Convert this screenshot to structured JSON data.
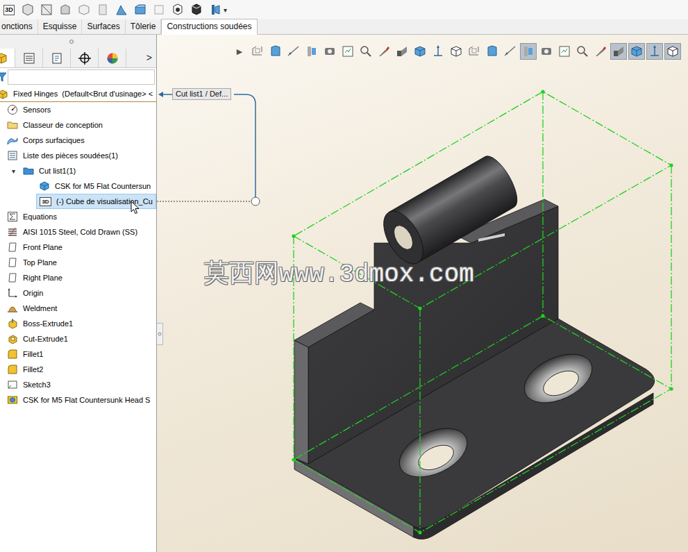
{
  "toolbar": {
    "badge": "3D",
    "dropdown": "▾"
  },
  "tabs": [
    {
      "label": "onctions",
      "selected": false
    },
    {
      "label": "Esquisse",
      "selected": false
    },
    {
      "label": "Surfaces",
      "selected": false
    },
    {
      "label": "Tôlerie",
      "selected": false
    },
    {
      "label": "Constructions soudées",
      "selected": true
    }
  ],
  "panel": {
    "tabs": [
      {
        "selected": true
      },
      {
        "selected": false
      },
      {
        "selected": false
      },
      {
        "selected": false
      },
      {
        "selected": false
      }
    ],
    "more": ">"
  },
  "tree": {
    "items": [
      {
        "label": "Fixed Hinges  (Default<Brut d'usinage> <",
        "depth": 0,
        "selected": false
      },
      {
        "label": "Sensors",
        "depth": 1,
        "selected": false
      },
      {
        "label": "Classeur de conception",
        "depth": 1,
        "selected": false
      },
      {
        "label": "Corps surfaciques",
        "depth": 1,
        "selected": false
      },
      {
        "label": "Liste des pièces soudées(1)",
        "depth": 1,
        "selected": false
      },
      {
        "label": "Cut list1(1)",
        "depth": 2,
        "toggle": "▾",
        "expanded": true,
        "selected": false
      },
      {
        "label": "CSK for M5 Flat Countersun",
        "depth": 3,
        "selected": false
      },
      {
        "label": "(-) Cube de visualisation_Cu",
        "depth": 3,
        "tag": "3D",
        "selected": true
      },
      {
        "label": "Equations",
        "depth": 1,
        "selected": false
      },
      {
        "label": "AISI 1015 Steel, Cold Drawn (SS)",
        "depth": 1,
        "selected": false
      },
      {
        "label": "Front Plane",
        "depth": 1,
        "selected": false
      },
      {
        "label": "Top Plane",
        "depth": 1,
        "selected": false
      },
      {
        "label": "Right Plane",
        "depth": 1,
        "selected": false
      },
      {
        "label": "Origin",
        "depth": 1,
        "selected": false
      },
      {
        "label": "Weldment",
        "depth": 1,
        "selected": false
      },
      {
        "label": "Boss-Extrude1",
        "depth": 1,
        "selected": false
      },
      {
        "label": "Cut-Extrude1",
        "depth": 1,
        "selected": false
      },
      {
        "label": "Fillet1",
        "depth": 1,
        "selected": false
      },
      {
        "label": "Fillet2",
        "depth": 1,
        "selected": false
      },
      {
        "label": "Sketch3",
        "depth": 1,
        "selected": false
      },
      {
        "label": "CSK for M5 Flat Countersunk Head S",
        "depth": 1,
        "selected": false
      }
    ]
  },
  "callout": {
    "text": "Cut list1 / Def..."
  },
  "watermark": "莫西网www.3dmox.com",
  "view_toolbar": {
    "expand": "▶",
    "buttons": [
      {
        "selected": false
      },
      {
        "selected": false
      },
      {
        "selected": false
      },
      {
        "selected": false
      },
      {
        "selected": false
      },
      {
        "selected": false
      },
      {
        "selected": false
      },
      {
        "selected": false
      },
      {
        "selected": false
      },
      {
        "selected": false
      },
      {
        "selected": false
      },
      {
        "selected": false
      },
      {
        "selected": false
      },
      {
        "selected": false
      },
      {
        "selected": false
      },
      {
        "selected": true
      },
      {
        "selected": false
      },
      {
        "selected": false
      },
      {
        "selected": false
      },
      {
        "selected": false
      },
      {
        "selected": true
      },
      {
        "selected": true
      },
      {
        "selected": true
      },
      {
        "selected": true
      }
    ]
  }
}
